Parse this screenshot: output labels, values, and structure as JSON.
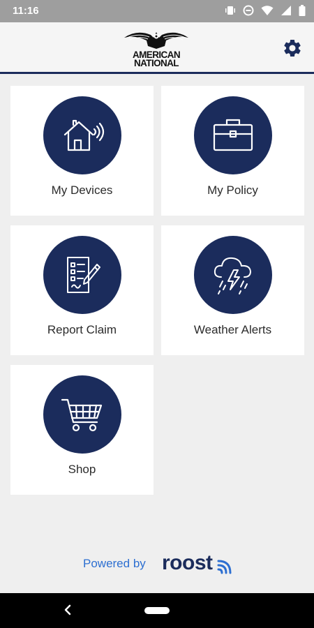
{
  "status_bar": {
    "time": "11:16",
    "icons": [
      "vibrate-icon",
      "do-not-disturb-icon",
      "wifi-icon",
      "signal-icon",
      "battery-icon"
    ]
  },
  "header": {
    "logo_line1": "AMERICAN",
    "logo_line2": "NATIONAL",
    "settings_icon": "gear-icon"
  },
  "tiles": [
    {
      "label": "My Devices",
      "icon": "smart-home-icon"
    },
    {
      "label": "My Policy",
      "icon": "briefcase-icon"
    },
    {
      "label": "Report Claim",
      "icon": "claim-form-icon"
    },
    {
      "label": "Weather Alerts",
      "icon": "storm-cloud-icon"
    },
    {
      "label": "Shop",
      "icon": "shopping-cart-icon"
    }
  ],
  "footer": {
    "powered_by": "Powered by",
    "brand": "roost"
  },
  "colors": {
    "navy": "#1b2c5c",
    "accent_blue": "#2d6fd1",
    "background": "#efefef"
  }
}
